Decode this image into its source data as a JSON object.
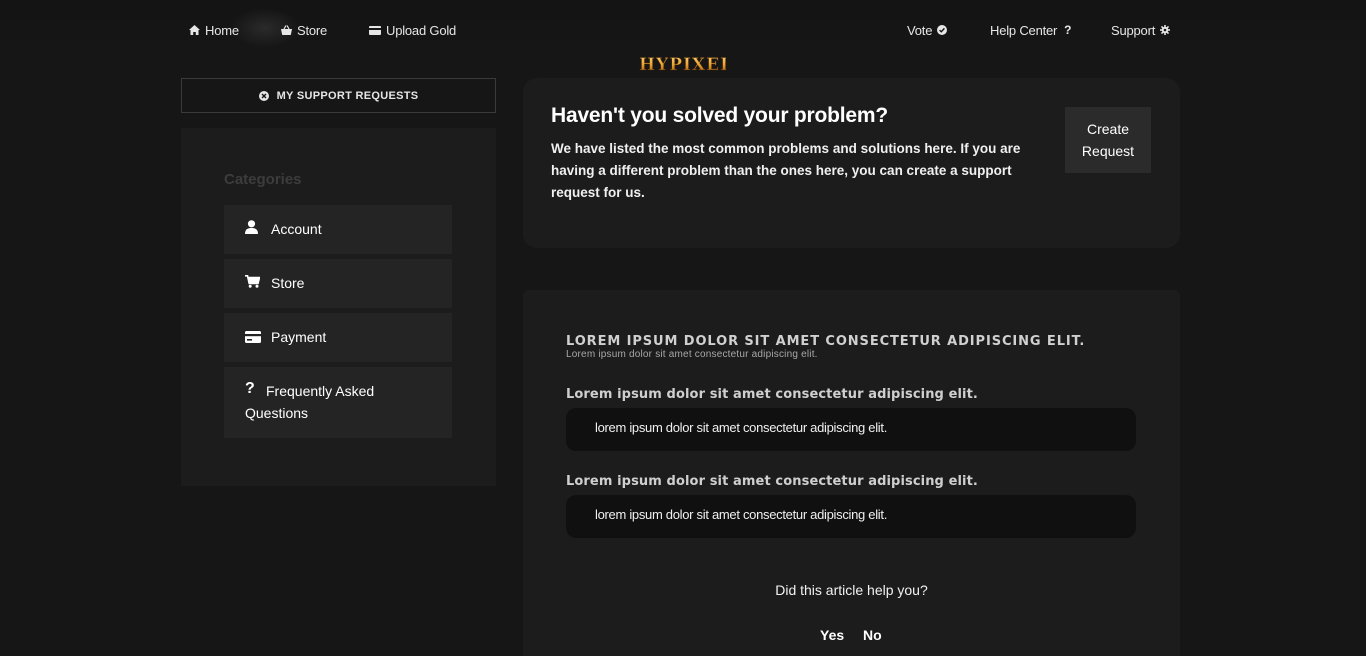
{
  "nav": {
    "home": "Home",
    "store": "Store",
    "upload_gold": "Upload Gold",
    "vote": "Vote",
    "help_center": "Help Center",
    "support": "Support"
  },
  "logo": {
    "text": "HYPIXEL"
  },
  "sidebar": {
    "my_requests": "MY SUPPORT REQUESTS",
    "categories_title": "Categories",
    "items": [
      {
        "label": "Account",
        "icon": "user-icon"
      },
      {
        "label": "Store",
        "icon": "cart-icon"
      },
      {
        "label": "Payment",
        "icon": "credit-card-icon"
      },
      {
        "label": "Frequently Asked Questions",
        "icon": "question-icon"
      }
    ]
  },
  "problem_card": {
    "title": "Haven't you solved your problem?",
    "description": "We have listed the most common problems and solutions here. If you are having a different problem than the ones here, you can create a support request for us.",
    "create_button": "Create Request"
  },
  "article": {
    "title": "LOREM IPSUM DOLOR SIT AMET CONSECTETUR ADIPISCING ELIT.",
    "subtitle": "Lorem ipsum dolor sit amet consectetur adipiscing elit.",
    "qa": [
      {
        "question": "Lorem ipsum dolor sit amet consectetur adipiscing elit.",
        "answer": "lorem ipsum dolor sit amet consectetur adipiscing elit."
      },
      {
        "question": "Lorem ipsum dolor sit amet consectetur adipiscing elit.",
        "answer": "lorem ipsum dolor sit amet consectetur adipiscing elit."
      }
    ],
    "helpful_prompt": "Did this article help you?",
    "yes": "Yes",
    "no": "No"
  },
  "colors": {
    "background": "#161616",
    "panel": "#1c1c1c",
    "item": "#242424",
    "logo_gold": "#e8a030"
  }
}
